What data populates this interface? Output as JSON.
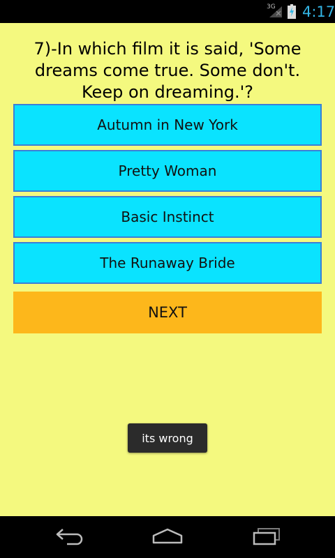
{
  "status_bar": {
    "network": "3G",
    "time": "4:17",
    "accent_color": "#33b5e5"
  },
  "quiz": {
    "question": "7)-In which film it is said, 'Some dreams come true. Some don't. Keep on dreaming.'?",
    "answers": [
      "Autumn in New York",
      "Pretty Woman",
      "Basic Instinct",
      "The Runaway Bride"
    ],
    "next_label": "NEXT",
    "colors": {
      "background": "#f4f97f",
      "answer_bg": "#0ae3ff",
      "answer_border": "#3c7fd6",
      "next_bg": "#fdb71b"
    }
  },
  "toast": {
    "message": "its wrong"
  },
  "nav_bar": {
    "icons": [
      "back-icon",
      "home-icon",
      "recent-apps-icon"
    ]
  }
}
